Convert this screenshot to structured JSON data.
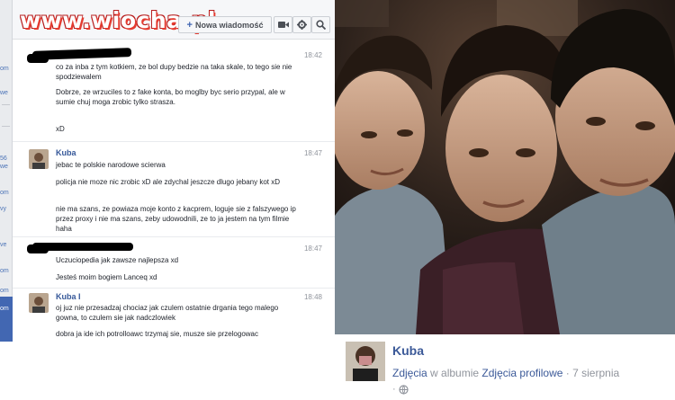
{
  "watermark": "www.wiocha.pl",
  "toolbar": {
    "new_message_label": "Nowa wiadomość",
    "video_icon": "video-camera-icon",
    "settings_icon": "gear-icon",
    "search_icon": "search-icon"
  },
  "sidebar_strip": {
    "labels": [
      "om",
      "we",
      "56",
      "we",
      "om",
      "vy",
      "ve",
      "om",
      "om"
    ],
    "bottom_label": "om"
  },
  "messages": [
    {
      "sender": "",
      "sender_redacted": true,
      "time": "18:42",
      "lines": [
        "co za inba z tym kotkiem, ze bol dupy bedzie na taka skale, to tego sie nie spodziewalem",
        "Dobrze, ze wrzuciles to z fake konta, bo moglby byc serio przypal, ale w sumie chuj moga zrobic tylko strasza.",
        "xD"
      ]
    },
    {
      "sender": "Kuba",
      "time": "18:47",
      "lines": [
        "jebac te polskie narodowe scierwa",
        "policja nie moze nic zrobic xD ale zdychal jeszcze dlugo jebany kot xD",
        "nie ma szans, ze powiaza moje konto z kacprem, loguje sie z falszywego ip przez proxy i nie ma szans, zeby udowodnili, ze to ja jestem na tym filmie haha"
      ]
    },
    {
      "sender": "",
      "sender_redacted": true,
      "time": "18:47",
      "lines": [
        "Uczuciopedia jak zawsze najlepsza xd",
        "Jesteś moim bogiem Lanceq xd"
      ]
    },
    {
      "sender": "Kuba I",
      "time": "18:48",
      "lines": [
        "oj juz nie przesadzaj chociaz jak czulem ostatnie drgania tego malego gowna, to czulem sie jak nadczlowiek",
        "dobra ja ide ich potrolloawc trzymaj sie, musze sie przelogowac"
      ]
    }
  ],
  "profile": {
    "name": "Kuba",
    "photos_label": "Zdjęcia",
    "in_album_label": "w albumie",
    "album_name": "Zdjęcia profilowe",
    "date": "· 7 sierpnia",
    "meta_separator": "·",
    "privacy_icon": "globe-icon"
  }
}
